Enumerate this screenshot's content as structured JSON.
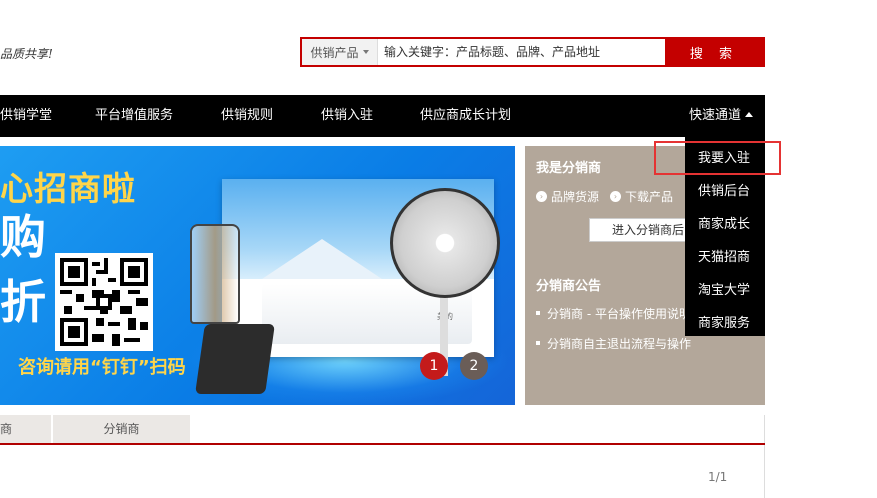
{
  "header": {
    "slogan": "品质共享!",
    "search": {
      "type_label": "供销产品",
      "placeholder": "输入关键字：产品标题、品牌、产品地址",
      "button_label": "搜 索"
    }
  },
  "nav": {
    "items": [
      "供销学堂",
      "平台增值服务",
      "供销规则",
      "供销入驻",
      "供应商成长计划"
    ],
    "quick_label": "快速通道"
  },
  "dropdown": {
    "items": [
      "我要入驻",
      "供销后台",
      "商家成长",
      "天猫招商",
      "淘宝大学",
      "商家服务"
    ]
  },
  "banner": {
    "title": "心招商啦",
    "big1": "购",
    "big2": "折",
    "consult": "咨询请用“钉钉”扫码",
    "heater_brand": "美的",
    "slides": [
      "1",
      "2"
    ]
  },
  "info": {
    "heading": "我是分销商",
    "tags": [
      "品牌货源",
      "下载产品"
    ],
    "enter_button": "进入分销商后台",
    "notice_heading": "分销商公告",
    "notices": [
      "分销商 - 平台操作使用说明",
      "分销商自主退出流程与操作"
    ]
  },
  "tabs": {
    "tab1": "商",
    "tab2": "分销商"
  },
  "pager": "1/1",
  "colors": {
    "brand_red": "#c40000",
    "nav_bg": "#000000",
    "info_bg": "#b3a79a",
    "banner_blue": "#0a7de6"
  }
}
